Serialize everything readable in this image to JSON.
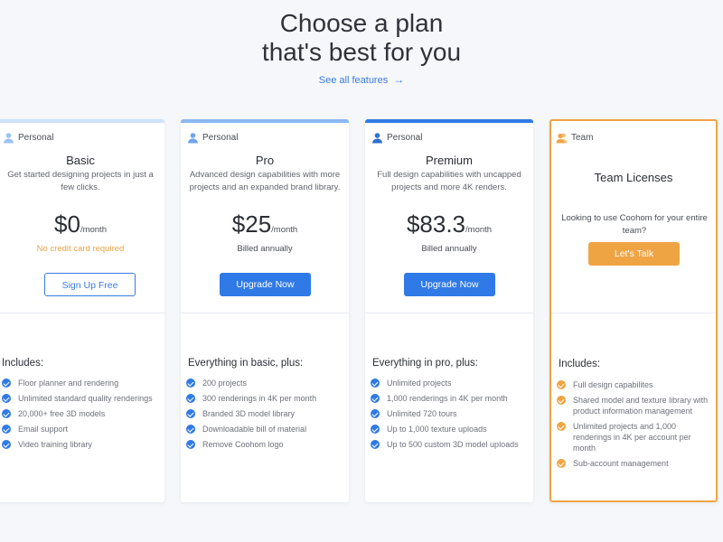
{
  "header": {
    "title_line1": "Choose a plan",
    "title_line2": "that's best for you",
    "see_all": "See all features",
    "see_all_arrow": "→"
  },
  "colors": {
    "accent_blue": "#2f7ae6",
    "light_blue": "#8bb8f0",
    "pale_blue": "#cfe3fb",
    "orange": "#efa444"
  },
  "plans": [
    {
      "tier": "Personal",
      "tier_icon": "user-icon",
      "name": "Basic",
      "description": "Get started designing projects in just a few clicks.",
      "price": "$0",
      "period": "/month",
      "note": "No credit card required",
      "button": "Sign Up Free",
      "includes_title": "Includes:",
      "features": [
        "Floor planner and rendering",
        "Unlimited standard quality renderings",
        "20,000+ free 3D models",
        "Email support",
        "Video training library"
      ]
    },
    {
      "tier": "Personal",
      "tier_icon": "user-icon",
      "name": "Pro",
      "description": "Advanced design capabilities with more projects and an expanded brand library.",
      "price": "$25",
      "period": "/month",
      "note": "Billed annually",
      "button": "Upgrade Now",
      "includes_title": "Everything in basic, plus:",
      "features": [
        "200 projects",
        "300 renderings in 4K per month",
        "Branded 3D model library",
        "Downloadable bill of material",
        "Remove Coohom logo"
      ]
    },
    {
      "tier": "Personal",
      "tier_icon": "user-icon",
      "name": "Premium",
      "description": "Full design capabilities with uncapped projects and more 4K renders.",
      "price": "$83.3",
      "period": "/month",
      "note": "Billed annually",
      "button": "Upgrade Now",
      "includes_title": "Everything in pro, plus:",
      "features": [
        "Unlimited projects",
        "1,000 renderings in 4K per month",
        "Unlimited 720 tours",
        "Up to 1,000 texture uploads",
        "Up to 500 custom 3D model uploads"
      ]
    },
    {
      "tier": "Team",
      "tier_icon": "team-icon",
      "name": "Team Licenses",
      "description": "Looking to use Coohom for your entire team?",
      "button": "Let's Talk",
      "includes_title": "Includes:",
      "features": [
        "Full design capabilites",
        "Shared model and texture library with product information management",
        "Unlimited projects and 1,000 renderings in 4K per account per month",
        "Sub-account management"
      ]
    }
  ]
}
